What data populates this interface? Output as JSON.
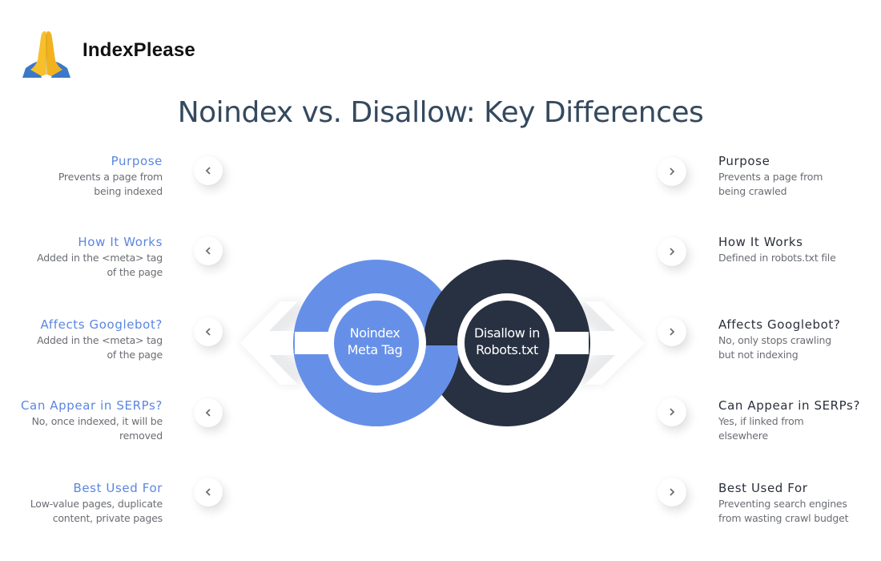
{
  "brand": {
    "name": "IndexPlease",
    "icon": "folded-hands-emoji"
  },
  "title": "Noindex vs. Disallow: Key Differences",
  "colors": {
    "noindex": "#6690e8",
    "disallow": "#283142",
    "left_heading": "#5b86e0",
    "right_heading": "#2b2f3a",
    "title": "#34495e"
  },
  "center": {
    "noindex_label": [
      "Noindex",
      "Meta Tag"
    ],
    "disallow_label": [
      "Disallow in",
      "Robots.txt"
    ]
  },
  "noindex": {
    "rows": [
      {
        "heading": "Purpose",
        "desc": [
          "Prevents a page from",
          "being indexed"
        ],
        "icon": "chevron-left-icon"
      },
      {
        "heading": "How It Works",
        "desc": [
          "Added in the <meta> tag",
          "of the page"
        ],
        "icon": "chevron-left-icon"
      },
      {
        "heading": "Affects Googlebot?",
        "desc": [
          "Added in the <meta> tag",
          "of the page"
        ],
        "icon": "chevron-left-icon"
      },
      {
        "heading": "Can Appear in SERPs?",
        "desc": [
          "No, once indexed, it will be",
          "removed"
        ],
        "icon": "chevron-left-icon"
      },
      {
        "heading": "Best Used For",
        "desc": [
          "Low-value pages, duplicate",
          "content, private pages"
        ],
        "icon": "chevron-left-icon"
      }
    ]
  },
  "disallow": {
    "rows": [
      {
        "heading": "Purpose",
        "desc": [
          "Prevents a page from",
          "being crawled"
        ],
        "icon": "chevron-right-icon"
      },
      {
        "heading": "How It Works",
        "desc": [
          "Defined in robots.txt file"
        ],
        "icon": "chevron-right-icon"
      },
      {
        "heading": "Affects Googlebot?",
        "desc": [
          "No, only stops crawling",
          "but not indexing"
        ],
        "icon": "chevron-right-icon"
      },
      {
        "heading": "Can Appear in SERPs?",
        "desc": [
          "Yes, if linked from",
          "elsewhere"
        ],
        "icon": "chevron-right-icon"
      },
      {
        "heading": "Best Used For",
        "desc": [
          "Preventing search engines",
          "from wasting crawl budget"
        ],
        "icon": "chevron-right-icon"
      }
    ]
  }
}
